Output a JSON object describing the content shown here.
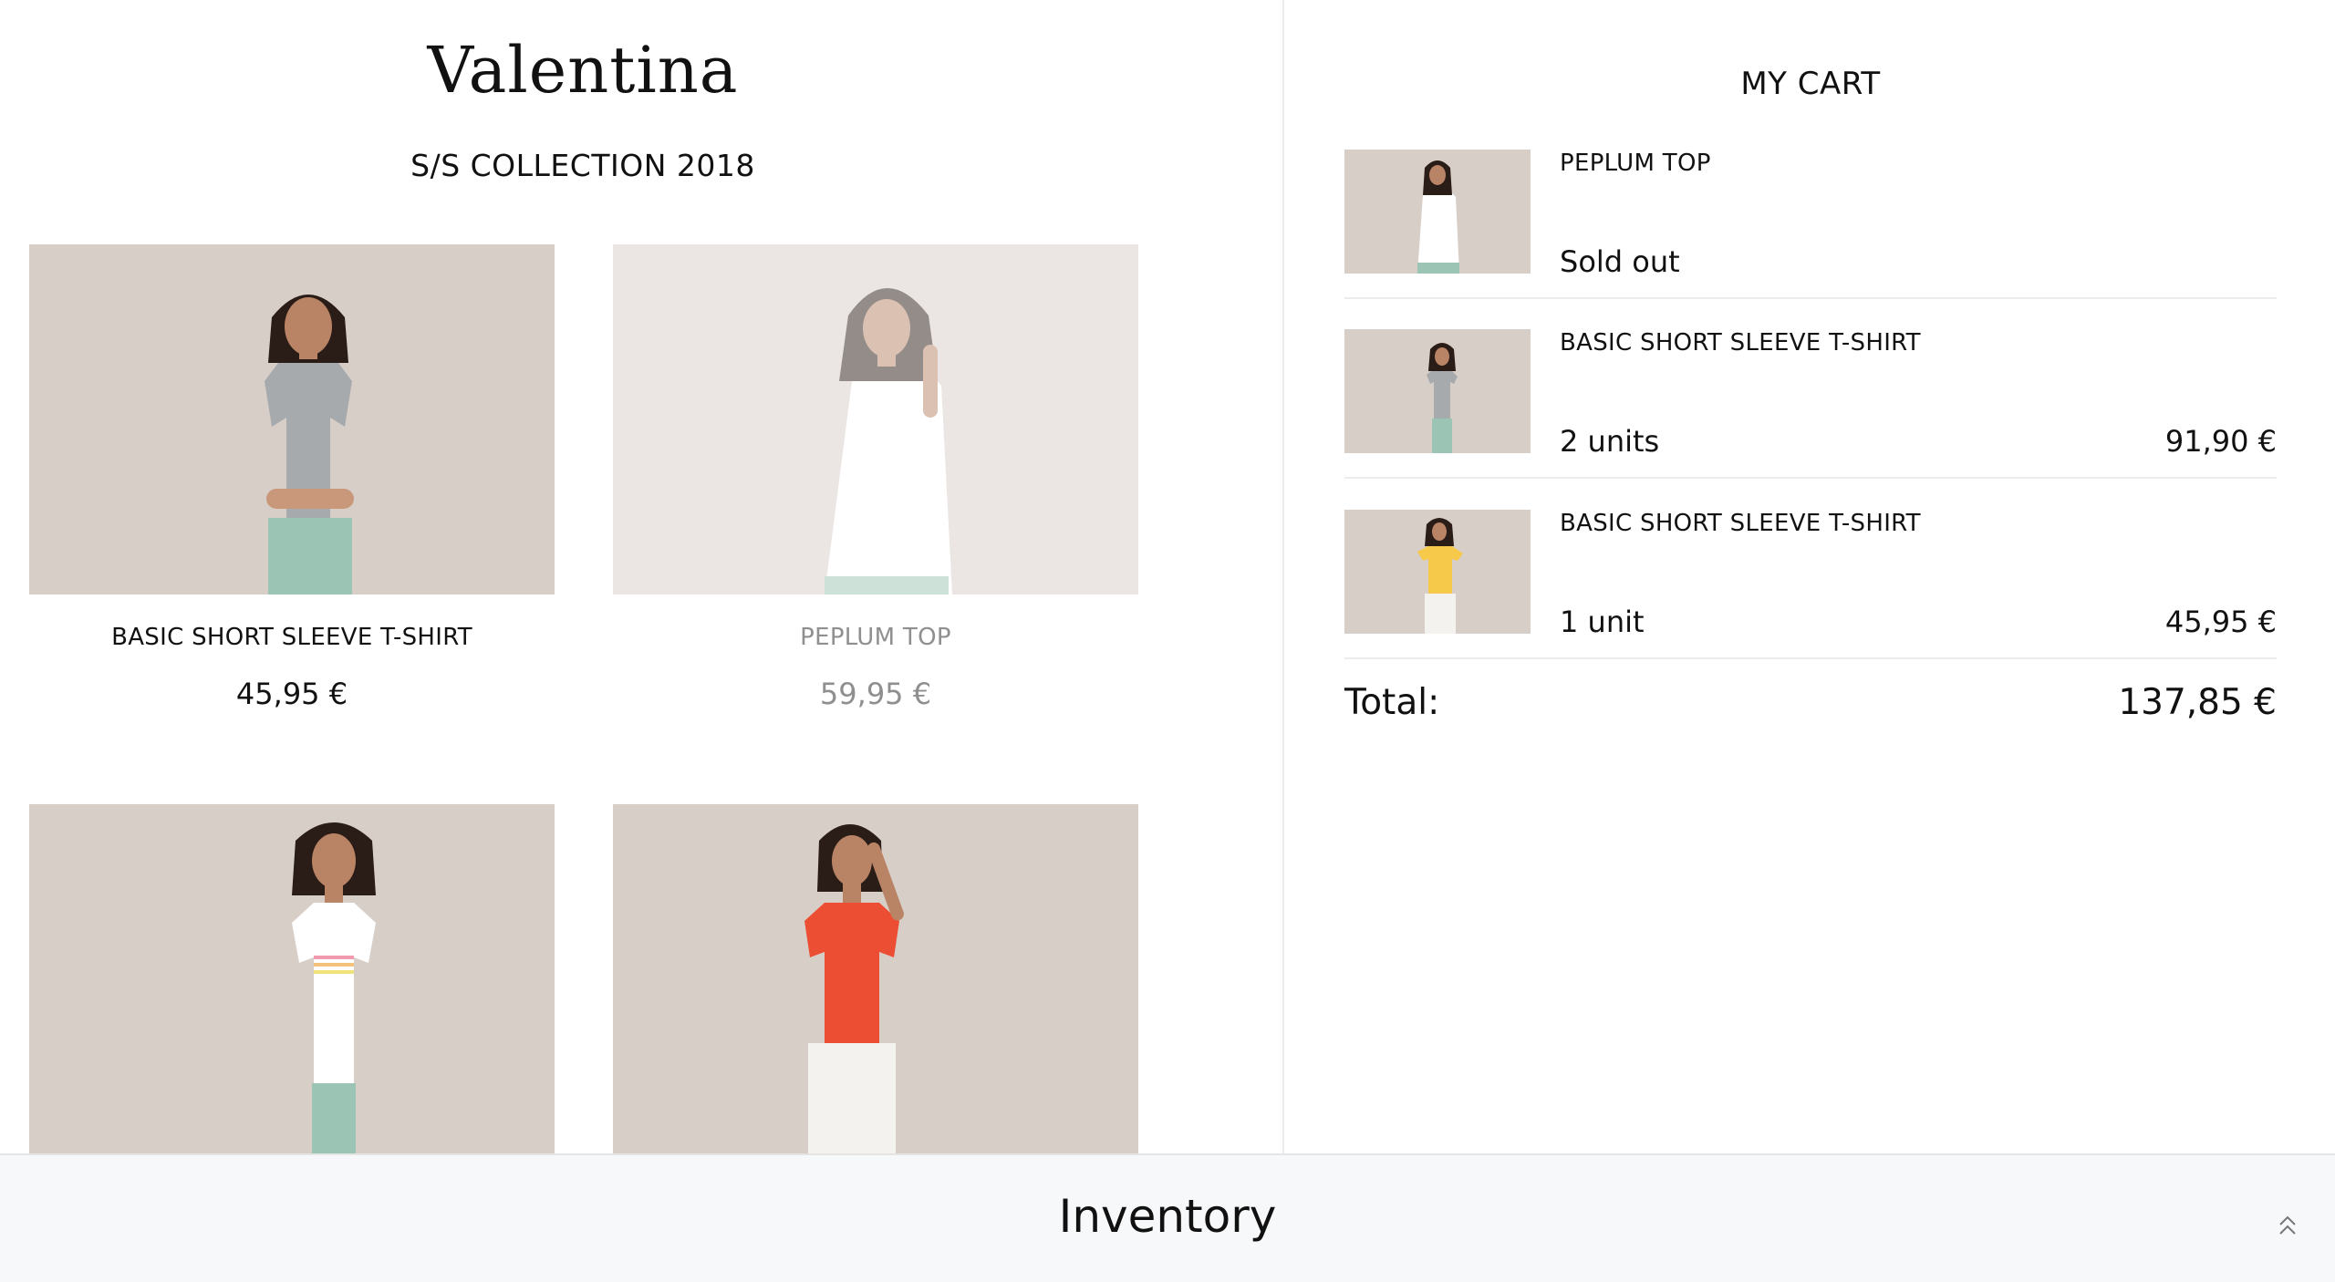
{
  "store": {
    "brand": "Valentina",
    "collection": "S/S COLLECTION 2018"
  },
  "products": [
    {
      "name": "BASIC SHORT SLEEVE T-SHIRT",
      "price": "45,95 €",
      "shirt_color": "#a7aaad",
      "pants_color": "#9cc4b4",
      "sold_out": false
    },
    {
      "name": "PEPLUM TOP",
      "price": "59,95 €",
      "shirt_color": "#ffffff",
      "pants_color": "#9cc4b4",
      "sold_out": true
    },
    {
      "name": "",
      "price": "",
      "shirt_color": "#ffffff",
      "pants_color": "#9cc4b4",
      "sold_out": false
    },
    {
      "name": "",
      "price": "",
      "shirt_color": "#ec4e33",
      "pants_color": "#f4f2ee",
      "sold_out": false
    }
  ],
  "cart": {
    "title": "MY CART",
    "items": [
      {
        "name": "PEPLUM TOP",
        "qty": "Sold out",
        "price": "",
        "shirt_color": "#ffffff",
        "pants_color": "#9cc4b4"
      },
      {
        "name": "BASIC SHORT SLEEVE T-SHIRT",
        "qty": "2 units",
        "price": "91,90 €",
        "shirt_color": "#a7aaad",
        "pants_color": "#9cc4b4"
      },
      {
        "name": "BASIC SHORT SLEEVE T-SHIRT",
        "qty": "1 unit",
        "price": "45,95 €",
        "shirt_color": "#f6c94a",
        "pants_color": "#f4f2ee"
      }
    ],
    "total_label": "Total:",
    "total_value": "137,85 €"
  },
  "footer": {
    "title": "Inventory",
    "toggle_icon": "chevron-double-up-icon"
  },
  "colors": {
    "photo_background": "#d7cdc7",
    "divider": "#ececec",
    "footer_background": "#f7f8f9"
  }
}
